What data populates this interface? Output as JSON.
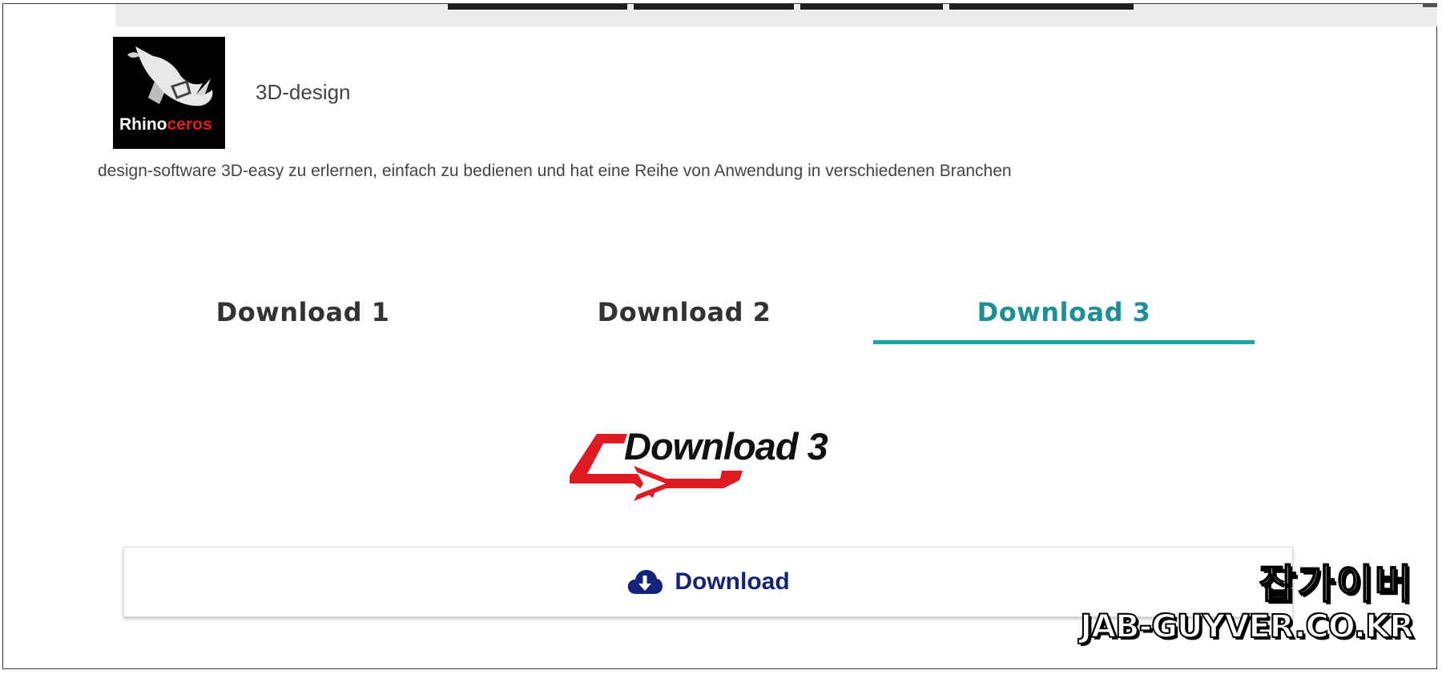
{
  "app": {
    "logo_name": "rhinoceros-logo",
    "logo_text_white": "Rhino",
    "logo_text_red": "ceros",
    "category": "3D-design",
    "description": "design-software 3D-easy zu erlernen, einfach zu bedienen und hat eine Reihe von Anwendung in verschiedenen Branchen"
  },
  "tabs": [
    {
      "label": "Download 1",
      "active": false
    },
    {
      "label": "Download 2",
      "active": false
    },
    {
      "label": "Download 3",
      "active": true
    }
  ],
  "banner": {
    "text": "Download 3"
  },
  "download_button": {
    "label": "Download",
    "icon": "cloud-download-icon"
  },
  "watermark": {
    "korean": "잡가이버",
    "domain": "JAB-GUYVER.CO.KR"
  },
  "colors": {
    "active_tab": "#1f8f96",
    "active_underline": "#1fa2aa",
    "button_text": "#14237a",
    "banner_red": "#e01a22"
  }
}
